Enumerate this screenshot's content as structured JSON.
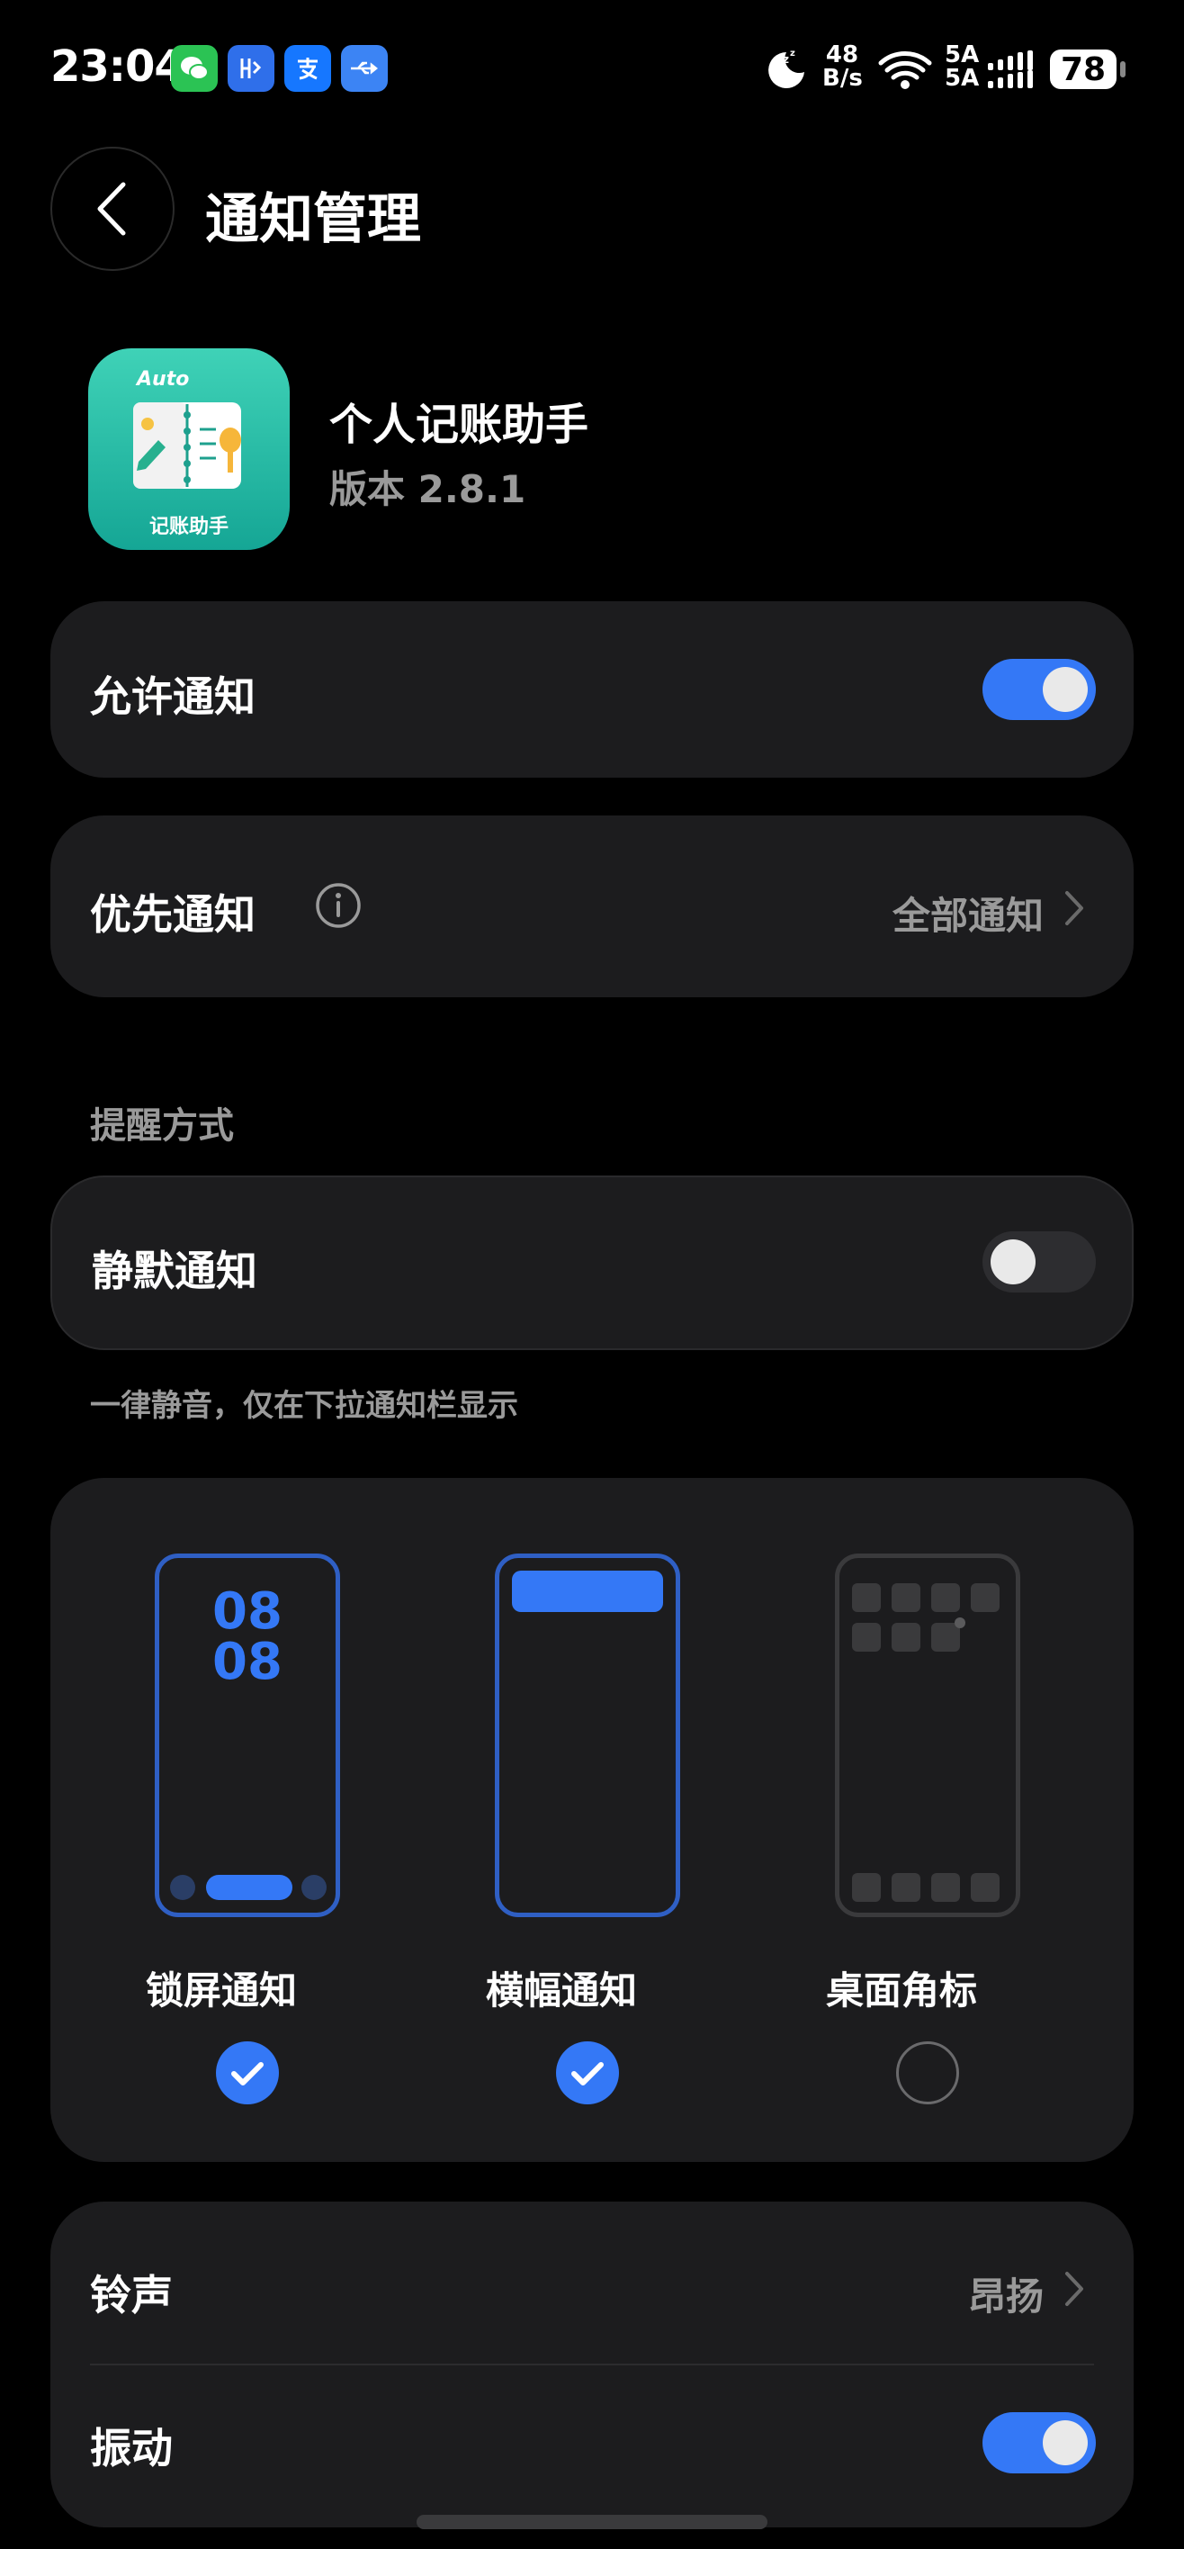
{
  "status_bar": {
    "time": "23:04",
    "network_speed_value": "48",
    "network_speed_unit": "B/s",
    "sim1": "5A",
    "sim2": "5A",
    "battery": "78",
    "app_icons": [
      "wechat-icon",
      "hi-app-icon",
      "alipay-icon",
      "usb-icon"
    ]
  },
  "header": {
    "title": "通知管理"
  },
  "app": {
    "name": "个人记账助手",
    "version": "版本 2.8.1",
    "icon_label_top": "Auto",
    "icon_label_bottom": "记账助手"
  },
  "allow_notifications": {
    "label": "允许通知",
    "enabled": true
  },
  "priority_notifications": {
    "label": "优先通知",
    "value": "全部通知"
  },
  "reminder_section": {
    "title": "提醒方式",
    "silent": {
      "label": "静默通知",
      "enabled": false
    },
    "hint": "一律静音，仅在下拉通知栏显示"
  },
  "notification_styles": [
    {
      "label": "锁屏通知",
      "checked": true,
      "preview_text_1": "08",
      "preview_text_2": "08"
    },
    {
      "label": "横幅通知",
      "checked": true
    },
    {
      "label": "桌面角标",
      "checked": false
    }
  ],
  "sound": {
    "ringtone_label": "铃声",
    "ringtone_value": "昂扬",
    "vibration_label": "振动",
    "vibration_enabled": true
  },
  "colors": {
    "accent": "#3478f6",
    "card": "#1c1c1e",
    "secondary_text": "#9a9a9a"
  }
}
